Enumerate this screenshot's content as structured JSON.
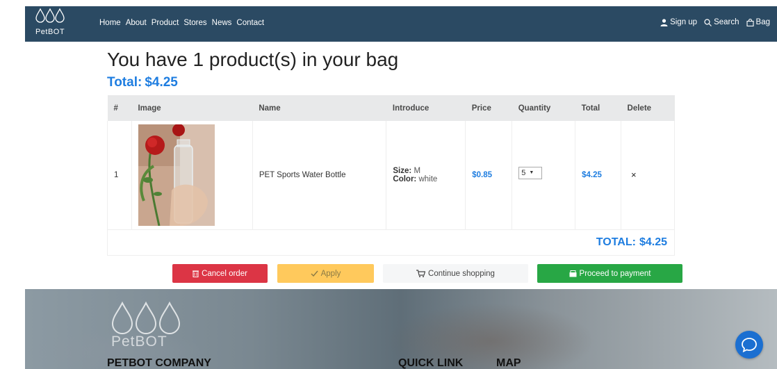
{
  "brand": {
    "name": "PetBOT"
  },
  "nav": {
    "links": [
      "Home",
      "About",
      "Product",
      "Stores",
      "News",
      "Contact"
    ],
    "signup": "Sign up",
    "search": "Search",
    "bag": "Bag"
  },
  "cart": {
    "heading": "You have 1 product(s) in your bag",
    "total_label": "Total:",
    "total_value": "$4.25",
    "columns": [
      "#",
      "Image",
      "Name",
      "Introduce",
      "Price",
      "Quantity",
      "Total",
      "Delete"
    ],
    "rows": [
      {
        "index": "1",
        "name": "PET Sports Water Bottle",
        "size_label": "Size:",
        "size_value": "M",
        "color_label": "Color:",
        "color_value": "white",
        "price": "$0.85",
        "quantity": "5",
        "total": "$4.25",
        "delete": "×"
      }
    ],
    "grand_total_label": "TOTAL:",
    "grand_total_value": "$4.25"
  },
  "actions": {
    "cancel": "Cancel order",
    "apply": "Apply",
    "continue": "Continue shopping",
    "pay": "Proceed to payment"
  },
  "footer": {
    "logo_text": "PetBOT",
    "company": "PETBOT COMPANY",
    "quick_link": "QUICK LINK",
    "map": "MAP"
  },
  "colors": {
    "navbar": "#2b4a63",
    "accent_blue": "#1e7de0",
    "cancel_red": "#dc3545",
    "apply_yellow": "#ffc95c",
    "pay_green": "#28a745",
    "chat_blue": "#1b6fd1"
  },
  "icons": [
    "drops-logo-icon",
    "user-icon",
    "search-icon",
    "bag-icon",
    "trash-icon",
    "check-icon",
    "cart-icon",
    "wallet-icon",
    "chat-icon"
  ]
}
